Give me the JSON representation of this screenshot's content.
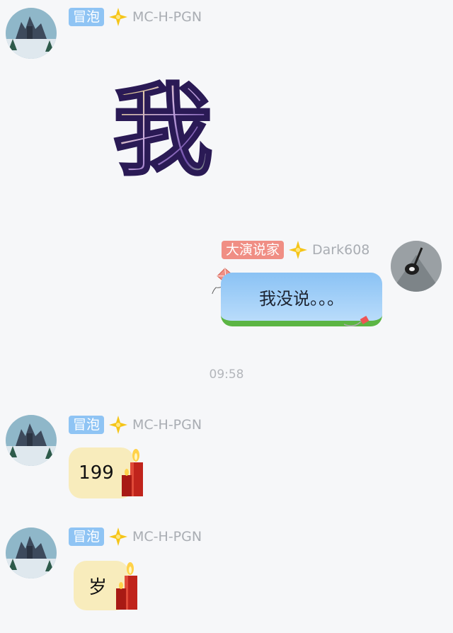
{
  "messages": [
    {
      "badge": "冒泡",
      "nick": "MC-H-PGN",
      "sticker_text": "我"
    },
    {
      "badge": "大演说家",
      "nick": "Dark608",
      "text": "我没说。。。"
    },
    {
      "badge": "冒泡",
      "nick": "MC-H-PGN",
      "text": "199"
    },
    {
      "badge": "冒泡",
      "nick": "MC-H-PGN",
      "text": "岁"
    }
  ],
  "timestamp": "09:58",
  "colors": {
    "badge_blue": "#8fc4f4",
    "badge_red": "#f08e84",
    "star": "#f5c518"
  }
}
